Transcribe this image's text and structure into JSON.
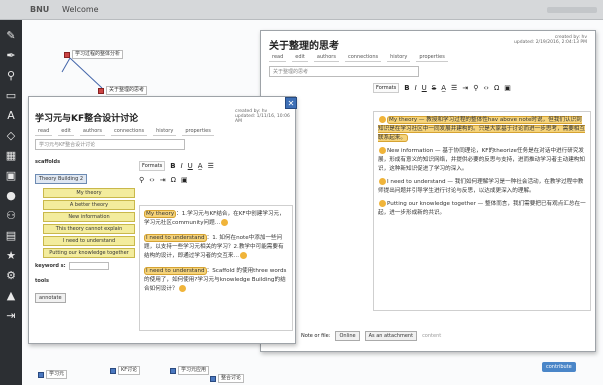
{
  "topbar": {
    "app": "BNU",
    "title": "Welcome"
  },
  "tools": [
    "pencil-icon",
    "pen-icon",
    "link-icon",
    "note-icon",
    "text-icon",
    "shapes-icon",
    "chart-icon",
    "image-icon",
    "user-icon",
    "group-icon",
    "folder-icon",
    "star-icon",
    "gear-icon",
    "map-icon",
    "export-icon"
  ],
  "nodes": [
    {
      "label": "学习过程的整体分析"
    },
    {
      "label": "关于整理的思考"
    }
  ],
  "back_window": {
    "title": "关于整理的思考",
    "meta1": "created by: hv",
    "meta2": "updated: 2/19/2016, 2:04:13 PM",
    "tabs": [
      "read",
      "edit",
      "authors",
      "connections",
      "history",
      "properties"
    ],
    "input_value": "关于整理的思考",
    "toolbar": {
      "format": "Formats",
      "bold": "B",
      "italic": "I",
      "underline": "U",
      "strike": "S"
    },
    "content": [
      "My theory — 教授和学习过程的整体性hav above note时说，但我们认识到知识是在学习社区中一同发展并建构的。只是大家基于讨论而进一步思考，需要相互联系起来。",
      "New information — 基于协同理论，KF的theorize任务是在对话中进行研究发展，形成有意义的知识网络，并提供必要的反思与支持，进而推动学习者主动建构知识，这种新知识促进了学习的深入。",
      "I need to understand — 我们如何理解学习是一种社会活动，在教学过程中教师提出问题并引导学生进行讨论与反思，以达成更深入的理解。",
      "Putting our knowledge together — 整体而言，我们需要把已有观点汇总在一起，进一步形成新的共识。"
    ],
    "attach_label": "Note or file:",
    "attach_online": "Online",
    "attach_button": "As an attachment",
    "bottom_label": "content"
  },
  "front_window": {
    "title": "学习元与KF整合设计讨论",
    "meta1": "created by: hv",
    "meta2": "updated: 1/11/16, 10:06 AM",
    "tabs": [
      "read",
      "edit",
      "authors",
      "connections",
      "history",
      "properties"
    ],
    "input_value": "学习元与KF整合设计讨论",
    "scaffold_header": "Theory Building 2",
    "scaffold_title": "scaffolds",
    "scaffolds": [
      "My theory",
      "A better theory",
      "New information",
      "This theory cannot explain",
      "I need to understand",
      "Putting our knowledge together"
    ],
    "keyword_label": "keyword s:",
    "tools_label": "tools",
    "tools_button": "annotate",
    "toolbar": {
      "format": "Formats",
      "bold": "B",
      "italic": "I",
      "underline": "U",
      "strike": "S"
    },
    "content": [
      {
        "tag": "My theory",
        "text": "：1.学习元与KF结合，在KF中创建学习元，学习元社区community问题…"
      },
      {
        "tag": "I need to understand",
        "text": "：1. 如何在note中添加一些问题，以支持一些学习元相关的学习？2.教学中可能需要有结构的设计，即通过学习者的交互来…"
      },
      {
        "tag": "I need to understand",
        "text": "：Scaffold 的使用three words的使用了，如何使用?学习元与knowledge Building的结合如何设计？"
      }
    ]
  },
  "footer": {
    "contribute": "contribute"
  },
  "bottom_nodes": [
    "学习元",
    "KF讨论",
    "学习元应用",
    "整合讨论"
  ]
}
